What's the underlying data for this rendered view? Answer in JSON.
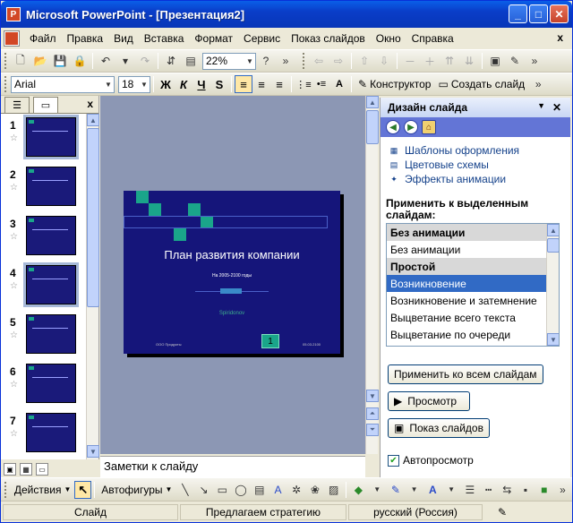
{
  "window": {
    "title": "Microsoft PowerPoint - [Презентация2]",
    "app_letter": "P"
  },
  "menu": [
    "Файл",
    "Правка",
    "Вид",
    "Вставка",
    "Формат",
    "Сервис",
    "Показ слайдов",
    "Окно",
    "Справка"
  ],
  "menu_close": "x",
  "toolbar": {
    "zoom": "22%",
    "font": "Arial",
    "size": "18",
    "bold": "Ж",
    "italic": "К",
    "underline": "Ч",
    "shadow": "S",
    "designer": "Конструктор",
    "new_slide": "Создать слайд"
  },
  "slides_pane": {
    "close": "x",
    "numbers": [
      "1",
      "2",
      "3",
      "4",
      "5",
      "6",
      "7"
    ]
  },
  "slide": {
    "title": "План развития компании",
    "subtitle": "На 2005-2100 годы",
    "author": "Spiridonov",
    "footer_left": "ООО Продукты",
    "footer_right": "05.03.2100",
    "page_number": "1"
  },
  "notes_placeholder": "Заметки к слайду",
  "task_pane": {
    "title": "Дизайн слайда",
    "links": [
      "Шаблоны оформления",
      "Цветовые схемы",
      "Эффекты анимации"
    ],
    "apply_label": "Применить к выделенным слайдам:",
    "list": [
      {
        "text": "Без анимации",
        "kind": "group"
      },
      {
        "text": "Без анимации",
        "kind": "item"
      },
      {
        "text": "Простой",
        "kind": "group"
      },
      {
        "text": "Возникновение",
        "kind": "selected"
      },
      {
        "text": "Возникновение и затемнение",
        "kind": "item"
      },
      {
        "text": "Выцветание всего текста",
        "kind": "item"
      },
      {
        "text": "Выцветание по очереди",
        "kind": "item"
      }
    ],
    "apply_all": "Применить ко всем слайдам",
    "preview": "Просмотр",
    "slideshow": "Показ слайдов",
    "autopreview": "Автопросмотр"
  },
  "drawing": {
    "actions": "Действия",
    "autoshapes": "Автофигуры"
  },
  "statusbar": {
    "slide": "Слайд",
    "design": "Предлагаем стратегию",
    "language": "русский (Россия)"
  }
}
